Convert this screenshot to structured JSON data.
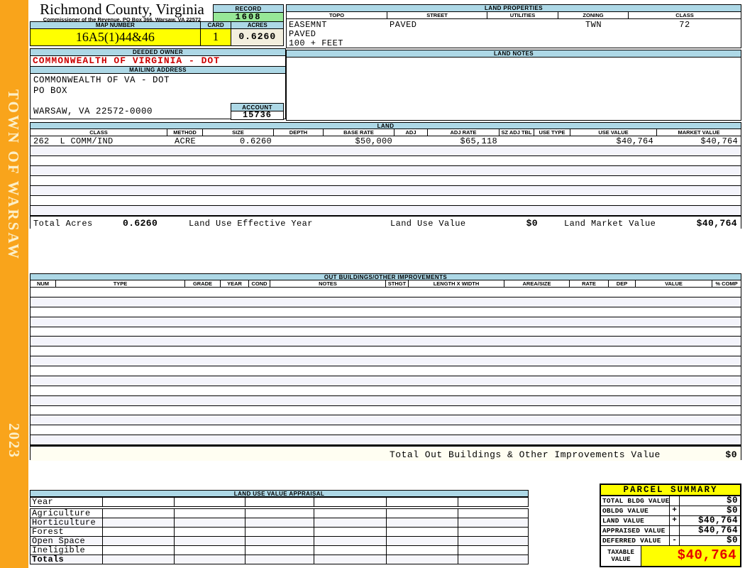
{
  "sidebar": {
    "town_label": "TOWN OF WARSAW",
    "year_label": "2023"
  },
  "header": {
    "title": "Richmond County, Virginia",
    "subtitle": "Commissioner of the Revenue, PO Box 366, Warsaw, VA 22572"
  },
  "record": {
    "label": "RECORD",
    "value": "1608"
  },
  "map_number": {
    "label": "MAP NUMBER",
    "value": "16A5(1)44&46"
  },
  "card": {
    "label": "CARD",
    "value": "1"
  },
  "acres": {
    "label": "ACRES",
    "value": "0.6260"
  },
  "land_properties": {
    "title": "LAND PROPERTIES",
    "columns": [
      "TOPO",
      "STREET",
      "UTILITIES",
      "ZONING",
      "CLASS"
    ],
    "topo_lines": [
      "EASEMNT",
      "PAVED",
      "100 + FEET"
    ],
    "street_value": "PAVED",
    "utilities_value": "",
    "zoning_value": "TWN",
    "class_value": "72"
  },
  "owner": {
    "deeded_label": "DEEDED OWNER",
    "deeded_value": "COMMONWEALTH OF VIRGINIA - DOT",
    "mailing_label": "MAILING ADDRESS",
    "address_line1": "COMMONWEALTH OF VA - DOT",
    "address_line2": "PO BOX",
    "address_line3": "WARSAW, VA 22572-0000"
  },
  "account": {
    "label": "ACCOUNT",
    "value": "15736"
  },
  "land_notes": {
    "title": "LAND NOTES"
  },
  "land": {
    "title": "LAND",
    "columns": [
      "CLASS",
      "METHOD",
      "SIZE",
      "DEPTH",
      "BASE RATE",
      "ADJ",
      "ADJ RATE",
      "SZ ADJ TBL",
      "USE TYPE",
      "USE VALUE",
      "MARKET VALUE"
    ],
    "row": {
      "class": "262  L COMM/IND",
      "method": "ACRE",
      "size": "0.6260",
      "depth": "",
      "base_rate": "$50,000",
      "adj": "",
      "adj_rate": "$65,118",
      "sz_adj_tbl": "",
      "use_type": "",
      "use_value": "$40,764",
      "market_value": "$40,764"
    },
    "totals": {
      "total_acres_label": "Total Acres",
      "total_acres": "0.6260",
      "effective_year_label": "Land Use Effective Year",
      "use_value_label": "Land Use Value",
      "use_value": "$0",
      "market_value_label": "Land Market Value",
      "market_value": "$40,764"
    }
  },
  "out_buildings": {
    "title": "OUT BUILDINGS/OTHER IMPROVEMENTS",
    "columns": [
      "NUM",
      "TYPE",
      "GRADE",
      "YEAR",
      "COND",
      "NOTES",
      "STHGT",
      "LENGTH X WIDTH",
      "AREA/SIZE",
      "RATE",
      "DEP",
      "VALUE",
      "% COMP"
    ],
    "total_label": "Total Out Buildings & Other Improvements Value",
    "total_value": "$0"
  },
  "land_use_appraisal": {
    "title": "LAND USE VALUE APPRAISAL",
    "rows": [
      "Year",
      "Agriculture",
      "Horticulture",
      "Forest",
      "Open Space",
      "Ineligible",
      "Totals"
    ]
  },
  "parcel_summary": {
    "title": "PARCEL SUMMARY",
    "rows": [
      {
        "label": "TOTAL BLDG VALUE",
        "op": "",
        "value": "$0"
      },
      {
        "label": "OBLDG VALUE",
        "op": "+",
        "value": "$0"
      },
      {
        "label": "LAND VALUE",
        "op": "+",
        "value": "$40,764"
      },
      {
        "label": "APPRAISED VALUE",
        "op": "",
        "value": "$40,764"
      },
      {
        "label": "DEFERRED VALUE",
        "op": "-",
        "value": "$0"
      }
    ],
    "taxable": {
      "label": "TAXABLE\nVALUE",
      "value": "$40,764"
    }
  },
  "colors": {
    "sidebar_orange": "#F9A41B",
    "section_blue": "#ADD8E6",
    "record_green": "#97E897",
    "highlight_yellow": "#FFFF00",
    "acres_cream": "#F3EFDE",
    "owner_red": "#CC0000",
    "taxable_red": "#E60000"
  }
}
